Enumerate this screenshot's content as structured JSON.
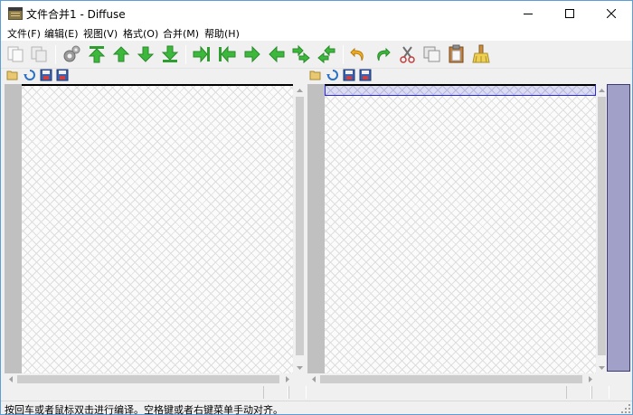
{
  "window": {
    "title": "文件合并1 - Diffuse"
  },
  "menu": {
    "items": [
      {
        "label": "文件(F)"
      },
      {
        "label": "编辑(E)"
      },
      {
        "label": "视图(V)"
      },
      {
        "label": "格式(O)"
      },
      {
        "label": "合并(M)"
      },
      {
        "label": "帮助(H)"
      }
    ]
  },
  "toolbar": {
    "buttons": [
      "copy-file-icon",
      "copy-pane-icon",
      "settings-icon",
      "first-change-icon",
      "previous-change-icon",
      "next-change-icon",
      "last-change-icon",
      "copy-right-icon",
      "copy-left-icon",
      "arrow-right-icon",
      "arrow-left-icon",
      "shift-right-icon",
      "shift-left-icon",
      "undo-icon",
      "redo-icon",
      "cut-icon",
      "copy-icon",
      "paste-icon",
      "clear-edits-icon"
    ]
  },
  "status": {
    "message": "按回车或者鼠标双击进行编译。空格键或者右键菜单手动对齐。"
  },
  "colors": {
    "accent_green": "#3cb83c",
    "accent_blue": "#2b2bd8",
    "overview": "#a0a0c8",
    "gutter": "#c0c0c0"
  }
}
